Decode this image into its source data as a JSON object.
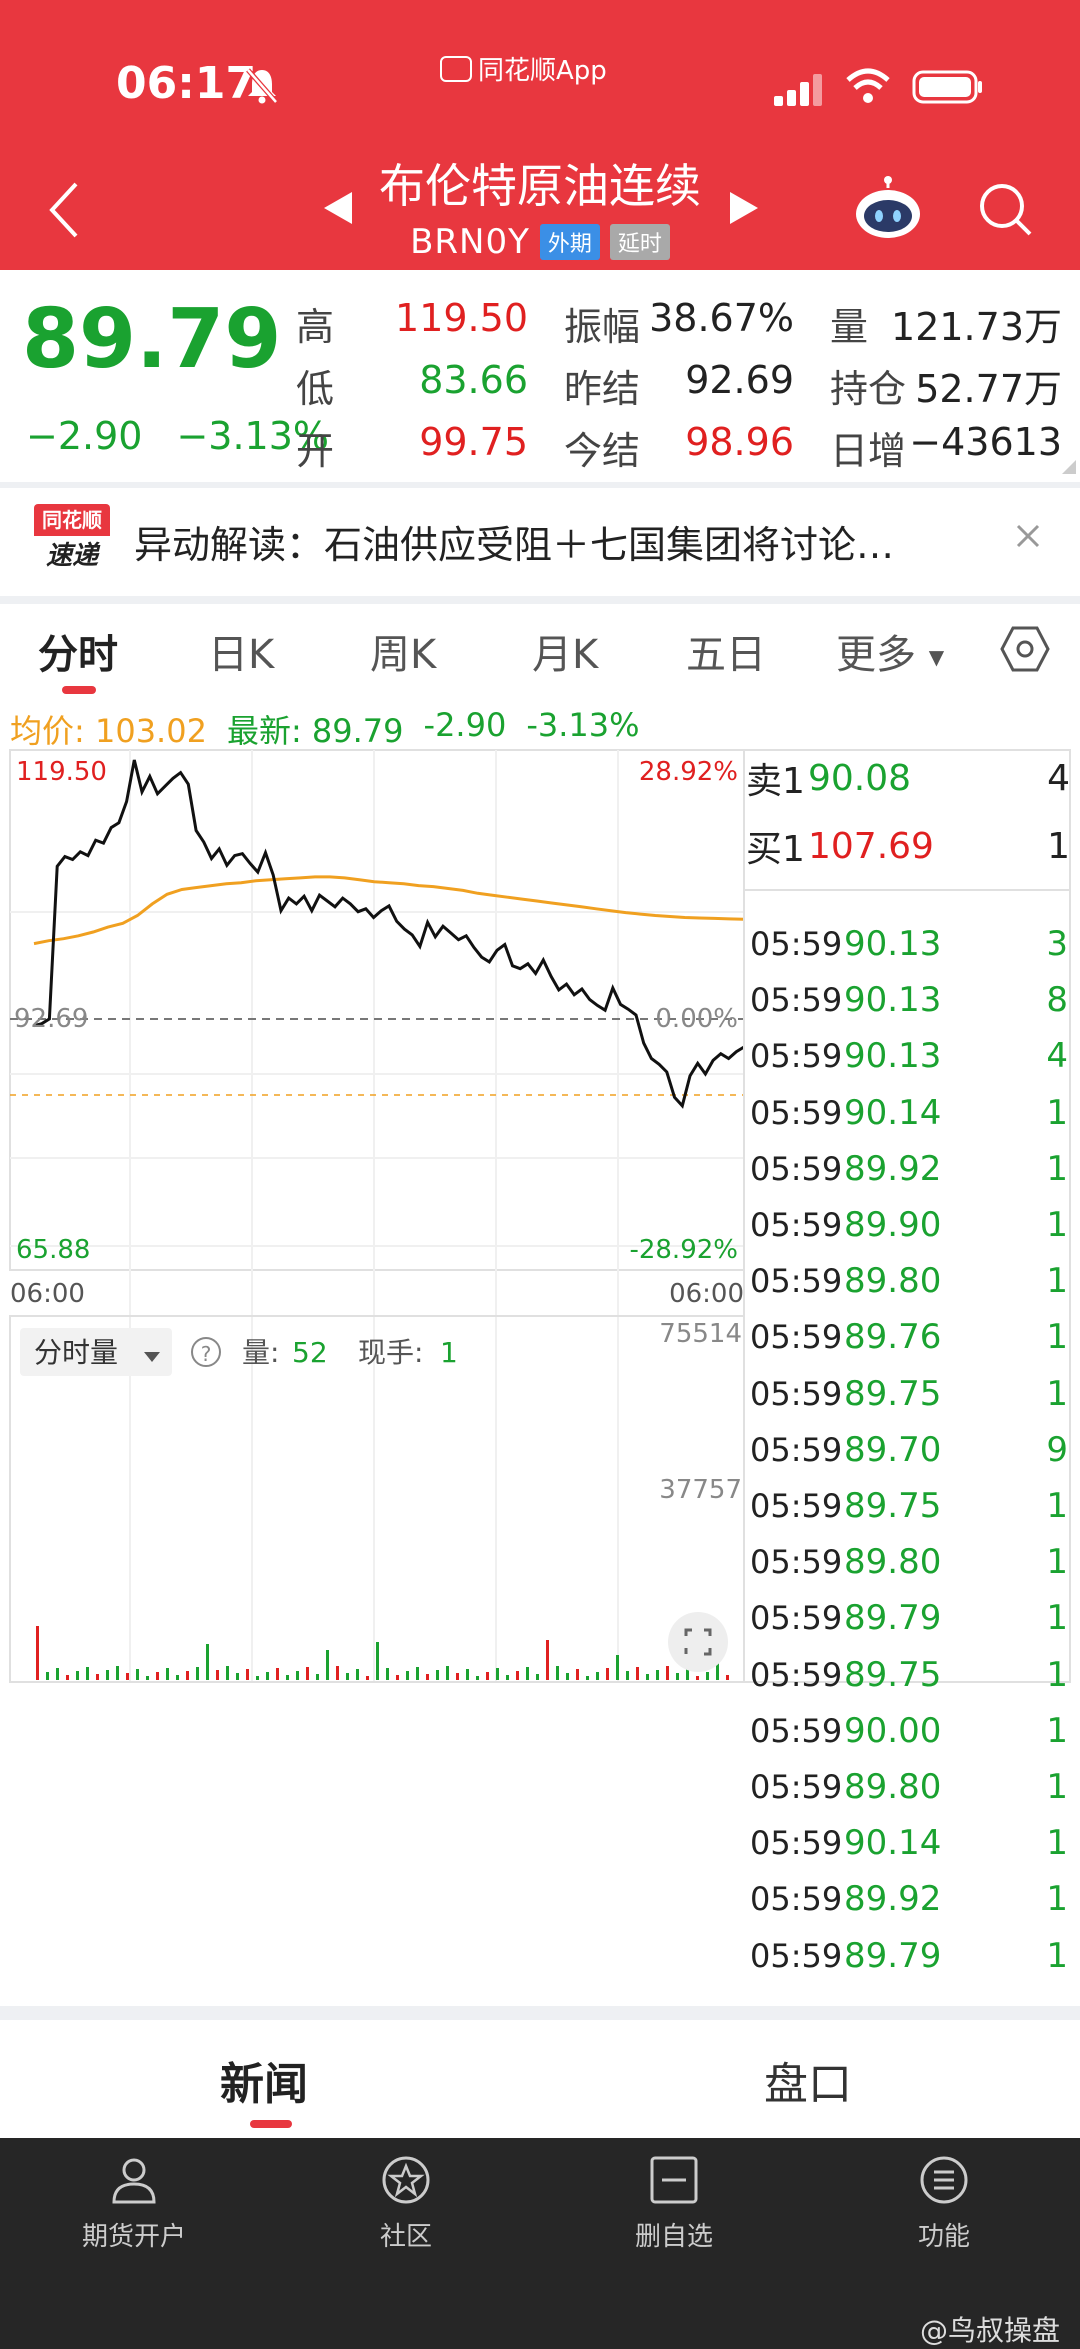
{
  "status": {
    "time": "06:17",
    "app_tag": "同花顺App"
  },
  "header": {
    "title": "布伦特原油连续",
    "code": "BRN0Y",
    "badge_market": "外期",
    "badge_delay": "延时"
  },
  "quote": {
    "price": "89.79",
    "change": "−2.90",
    "change_pct": "−3.13%",
    "fields": [
      {
        "label": "高",
        "value": "119.50",
        "tone": "red"
      },
      {
        "label": "低",
        "value": "83.66",
        "tone": "green"
      },
      {
        "label": "开",
        "value": "99.75",
        "tone": "red"
      },
      {
        "label": "振幅",
        "value": "38.67%",
        "tone": "dark"
      },
      {
        "label": "昨结",
        "value": "92.69",
        "tone": "dark"
      },
      {
        "label": "今结",
        "value": "98.96",
        "tone": "red"
      },
      {
        "label": "量",
        "value": "121.73万",
        "tone": "dark"
      },
      {
        "label": "持仓",
        "value": "52.77万",
        "tone": "dark"
      },
      {
        "label": "日增",
        "value": "−43613",
        "tone": "dark"
      }
    ]
  },
  "alert": {
    "logo_top": "同花顺",
    "logo_bottom": "速递",
    "text": "异动解读：石油供应受阻＋七国集团将讨论…"
  },
  "tabs": [
    "分时",
    "日K",
    "周K",
    "月K",
    "五日",
    "更多"
  ],
  "chart_header": {
    "avg_label": "均价:",
    "avg_value": "103.02",
    "latest_label": "最新:",
    "latest_value": "89.79",
    "latest_change": "-2.90",
    "latest_pct": "-3.13%"
  },
  "chart_labels": {
    "top_left": "119.50",
    "top_right": "28.92%",
    "mid_left": "92.69",
    "mid_right": "0.00%",
    "bottom_left": "65.88",
    "bottom_right": "-28.92%",
    "time_start": "06:00",
    "time_end": "06:00",
    "vol_max": "75514",
    "vol_mid": "37757",
    "vol_selector": "分时量",
    "vol_label": "量:",
    "vol_value": "52",
    "hand_label": "现手:",
    "hand_value": "1"
  },
  "chart_data": {
    "type": "line",
    "title": "",
    "ylim": [
      65.88,
      119.5
    ],
    "prev_settle": 92.69,
    "series": [
      {
        "name": "最新",
        "values": [
          92.0,
          92.2,
          92.7,
          108.5,
          109.5,
          109.2,
          110.0,
          109.6,
          111.2,
          110.9,
          112.5,
          113.0,
          115.2,
          119.5,
          116.2,
          117.8,
          116.0,
          116.8,
          117.6,
          118.2,
          117.0,
          112.2,
          111.0,
          109.3,
          110.3,
          108.6,
          109.6,
          109.8,
          108.8,
          107.9,
          109.9,
          107.6,
          103.9,
          105.2,
          104.6,
          105.4,
          103.9,
          105.5,
          104.9,
          104.3,
          105.2,
          104.6,
          103.8,
          104.1,
          103.2,
          103.9,
          104.4,
          102.8,
          102.0,
          101.4,
          100.2,
          102.7,
          101.2,
          102.3,
          101.6,
          100.9,
          101.3,
          100.1,
          99.1,
          98.6,
          99.8,
          100.4,
          98.2,
          97.9,
          98.4,
          97.4,
          98.8,
          97.1,
          95.7,
          96.3,
          95.2,
          95.8,
          94.7,
          94.1,
          93.6,
          95.9,
          94.2,
          93.7,
          93.1,
          90.2,
          88.6,
          88.0,
          87.2,
          84.6,
          83.7,
          86.8,
          88.1,
          87.0,
          88.4,
          89.1,
          88.6,
          89.3,
          89.79
        ]
      },
      {
        "name": "均价",
        "values": [
          100.5,
          100.8,
          101.0,
          101.3,
          101.7,
          102.2,
          102.6,
          103.4,
          104.6,
          105.6,
          106.1,
          106.3,
          106.5,
          106.7,
          106.8,
          107.0,
          107.1,
          107.2,
          107.3,
          107.4,
          107.4,
          107.3,
          107.1,
          106.9,
          106.8,
          106.7,
          106.5,
          106.4,
          106.2,
          106.0,
          105.7,
          105.5,
          105.3,
          105.1,
          104.9,
          104.7,
          104.5,
          104.3,
          104.1,
          103.9,
          103.7,
          103.55,
          103.4,
          103.3,
          103.2,
          103.15,
          103.1,
          103.05,
          103.02
        ]
      }
    ]
  },
  "order_book": [
    {
      "side": "卖1",
      "price": "90.08",
      "vol": "4",
      "tone": "green"
    },
    {
      "side": "买1",
      "price": "107.69",
      "vol": "1",
      "tone": "red"
    }
  ],
  "trades": [
    {
      "time": "05:59",
      "price": "90.13",
      "vol": "3"
    },
    {
      "time": "05:59",
      "price": "90.13",
      "vol": "8"
    },
    {
      "time": "05:59",
      "price": "90.13",
      "vol": "4"
    },
    {
      "time": "05:59",
      "price": "90.14",
      "vol": "1"
    },
    {
      "time": "05:59",
      "price": "89.92",
      "vol": "1"
    },
    {
      "time": "05:59",
      "price": "89.90",
      "vol": "1"
    },
    {
      "time": "05:59",
      "price": "89.80",
      "vol": "1"
    },
    {
      "time": "05:59",
      "price": "89.76",
      "vol": "1"
    },
    {
      "time": "05:59",
      "price": "89.75",
      "vol": "1"
    },
    {
      "time": "05:59",
      "price": "89.70",
      "vol": "9"
    },
    {
      "time": "05:59",
      "price": "89.75",
      "vol": "1"
    },
    {
      "time": "05:59",
      "price": "89.80",
      "vol": "1"
    },
    {
      "time": "05:59",
      "price": "89.79",
      "vol": "1"
    },
    {
      "time": "05:59",
      "price": "89.75",
      "vol": "1"
    },
    {
      "time": "05:59",
      "price": "90.00",
      "vol": "1"
    },
    {
      "time": "05:59",
      "price": "89.80",
      "vol": "1"
    },
    {
      "time": "05:59",
      "price": "90.14",
      "vol": "1"
    },
    {
      "time": "05:59",
      "price": "89.92",
      "vol": "1"
    },
    {
      "time": "05:59",
      "price": "89.79",
      "vol": "1"
    }
  ],
  "news_tabs": [
    "新闻",
    "盘口"
  ],
  "bottom_nav": [
    "期货开户",
    "社区",
    "删自选",
    "功能"
  ],
  "watermark": "@鸟叔操盘",
  "colors": {
    "brand_red": "#e8373f",
    "up_red": "#e02020",
    "down_green": "#1aa230",
    "avg_orange": "#f0a020"
  }
}
